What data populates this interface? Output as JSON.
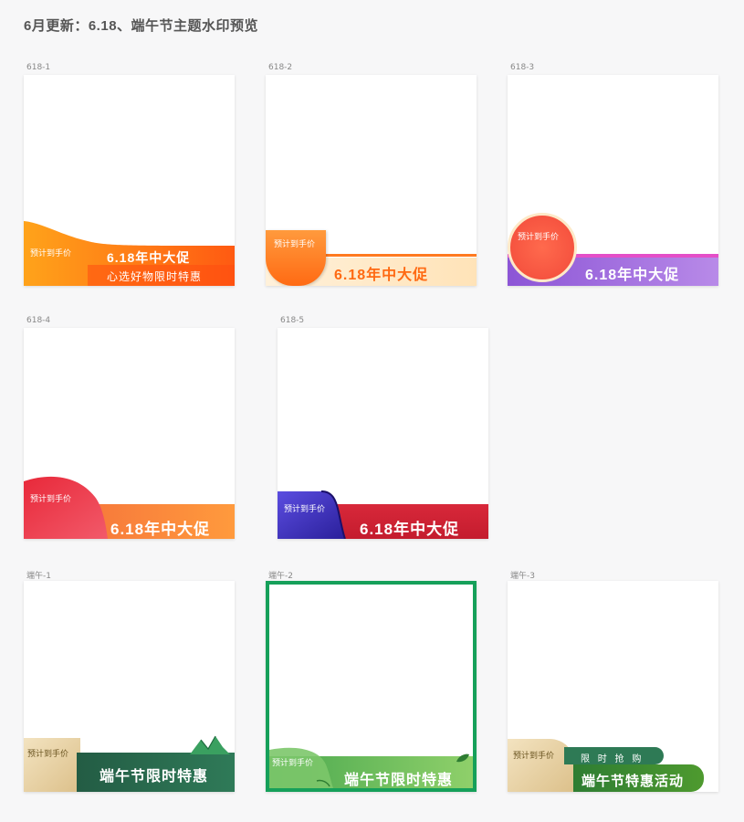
{
  "page": {
    "title": "6月更新：6.18、端午节主题水印预览"
  },
  "cards": [
    {
      "label": "618-1",
      "tag": "预计到手价",
      "main": "6.18年中大促",
      "sub": "心选好物限时特惠"
    },
    {
      "label": "618-2",
      "tag": "预计到手价",
      "main": "6.18年中大促"
    },
    {
      "label": "618-3",
      "tag": "预计到手价",
      "main": "6.18年中大促"
    },
    {
      "label": "618-4",
      "tag": "预计到手价",
      "main": "6.18年中大促"
    },
    {
      "label": "618-5",
      "tag": "预计到手价",
      "main": "6.18年中大促"
    },
    {
      "label": "端午-1",
      "tag": "预计到手价",
      "main": "端午节限时特惠"
    },
    {
      "label": "端午-2",
      "tag": "预计到手价",
      "main": "端午节限时特惠"
    },
    {
      "label": "端午-3",
      "tag": "预计到手价",
      "main": "端午节特惠活动",
      "sub": "限 时 抢 购"
    }
  ],
  "colors": {
    "orange": "#ff6a13",
    "red": "#e8293a",
    "purple": "#8a4fd3",
    "blue": "#3d2fb0",
    "green_dark": "#2d6a4f",
    "green_light": "#5cb85c",
    "green_border": "#16a05a",
    "beige": "#ead4a8"
  }
}
